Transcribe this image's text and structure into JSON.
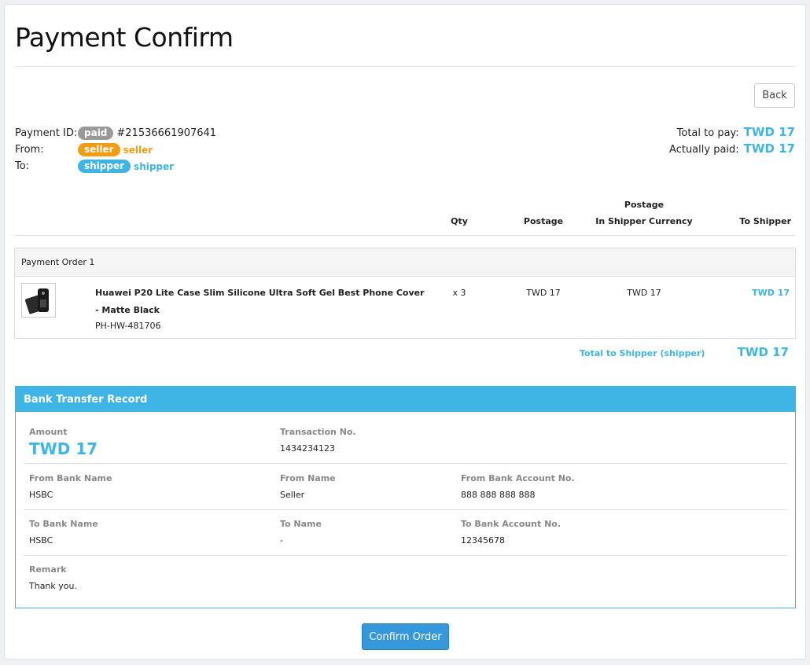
{
  "page": {
    "title": "Payment Confirm",
    "back_label": "Back"
  },
  "payment": {
    "id_label": "Payment ID:",
    "status_badge": "paid",
    "id_value": "#21536661907641",
    "from_label": "From:",
    "from_badge": "seller",
    "from_name": "seller",
    "to_label": "To:",
    "to_badge": "shipper",
    "to_name": "shipper"
  },
  "totals": {
    "total_label": "Total to pay:",
    "total_value": "TWD 17",
    "paid_label": "Actually paid:",
    "paid_value": "TWD 17"
  },
  "table": {
    "headers": {
      "qty": "Qty",
      "postage": "Postage",
      "postage_line1": "Postage",
      "postage_line2": "In Shipper Currency",
      "to_shipper": "To Shipper"
    }
  },
  "order": {
    "title": "Payment Order 1",
    "item": {
      "name": "Huawei P20 Lite Case Slim Silicone Ultra Soft Gel Best Phone Cover - Matte Black",
      "sku": "PH-HW-481706",
      "qty": "x 3",
      "postage": "TWD 17",
      "postage_shipper": "TWD 17",
      "to_shipper": "TWD 17"
    },
    "shipper_total_label": "Total to Shipper (shipper)",
    "shipper_total_value": "TWD 17"
  },
  "bank": {
    "title": "Bank Transfer Record",
    "amount_label": "Amount",
    "amount_value": "TWD 17",
    "txn_label": "Transaction No.",
    "txn_value": "1434234123",
    "from_bank_label": "From Bank Name",
    "from_bank_value": "HSBC",
    "from_name_label": "From Name",
    "from_name_value": "Seller",
    "from_acct_label": "From Bank Account No.",
    "from_acct_value": "888 888 888 888",
    "to_bank_label": "To Bank Name",
    "to_bank_value": "HSBC",
    "to_name_label": "To Name",
    "to_name_value": "-",
    "to_acct_label": "To Bank Account No.",
    "to_acct_value": "12345678",
    "remark_label": "Remark",
    "remark_value": "Thank you."
  },
  "actions": {
    "confirm_label": "Confirm Order"
  },
  "colors": {
    "accent": "#3fb5e6",
    "seller_badge": "#f39c12",
    "status_badge": "#999999",
    "confirm_button": "#3498db"
  }
}
